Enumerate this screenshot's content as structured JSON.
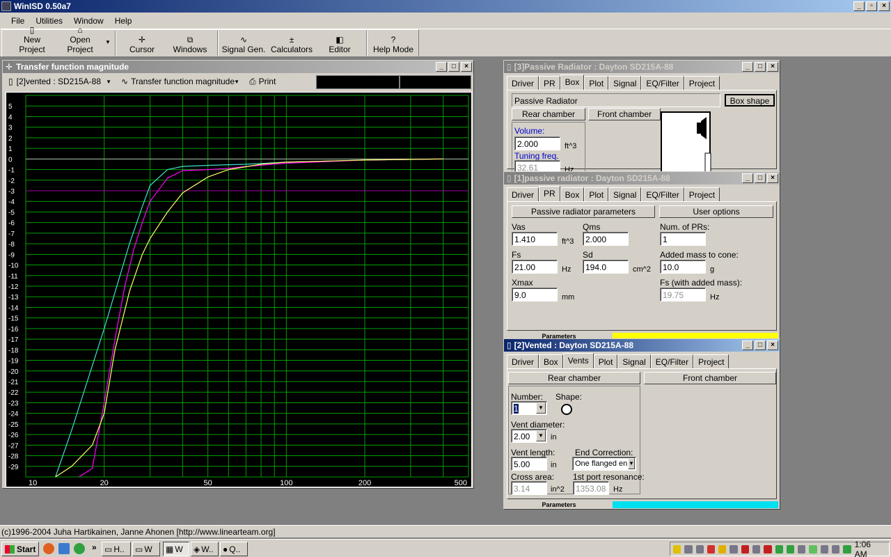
{
  "app": {
    "title": "WinISD 0.50a7"
  },
  "menu": [
    "File",
    "Utilities",
    "Window",
    "Help"
  ],
  "toolbar": [
    {
      "label": "New Project",
      "icon": "new-project-icon"
    },
    {
      "label": "Open Project",
      "icon": "open-project-icon"
    },
    {
      "label": "Cursor",
      "icon": "cursor-icon"
    },
    {
      "label": "Windows",
      "icon": "windows-icon"
    },
    {
      "label": "Signal Gen.",
      "icon": "signal-gen-icon"
    },
    {
      "label": "Calculators",
      "icon": "calculators-icon"
    },
    {
      "label": "Editor",
      "icon": "editor-icon"
    },
    {
      "label": "Help Mode",
      "icon": "help-icon"
    }
  ],
  "chart_window": {
    "title": "Transfer function magnitude",
    "project_select": "[2]vented : SD215A-88",
    "graph_select": "Transfer function magnitude",
    "print_label": "Print"
  },
  "chart_data": {
    "type": "line",
    "title": "Transfer function magnitude",
    "xlabel": "",
    "ylabel": "",
    "x_scale": "log",
    "xlim": [
      10,
      500
    ],
    "ylim": [
      -30,
      6
    ],
    "x_ticks": [
      "10",
      "20",
      "50",
      "100",
      "200",
      "500"
    ],
    "y_ticks": [
      "5",
      "4",
      "3",
      "2",
      "1",
      "0",
      "-1",
      "-2",
      "-3",
      "-4",
      "-5",
      "-6",
      "-7",
      "-8",
      "-9",
      "-10",
      "-11",
      "-12",
      "-13",
      "-14",
      "-15",
      "-16",
      "-17",
      "-18",
      "-19",
      "-20",
      "-21",
      "-22",
      "-23",
      "-24",
      "-25",
      "-26",
      "-27",
      "-28",
      "-29"
    ],
    "reference_line": -3,
    "grid": true,
    "series": [
      {
        "color": "#40e0d0",
        "x": [
          13,
          15,
          18,
          20,
          23,
          25,
          28,
          30,
          35,
          40,
          50,
          70,
          100,
          200
        ],
        "y": [
          -30,
          -25.6,
          -19.5,
          -16,
          -11,
          -8,
          -4.5,
          -2.5,
          -1,
          -0.7,
          -0.6,
          -0.5,
          -0.3,
          -0.1
        ]
      },
      {
        "color": "#ff00ff",
        "x": [
          16,
          18,
          20,
          22,
          24,
          26,
          28,
          30,
          35,
          40,
          50,
          60,
          70,
          100,
          200
        ],
        "y": [
          -30,
          -29.2,
          -23,
          -17,
          -12,
          -8.5,
          -6,
          -4,
          -1.8,
          -1.1,
          -1,
          -0.9,
          -0.7,
          -0.4,
          -0.1
        ]
      },
      {
        "color": "#ffff66",
        "x": [
          13,
          15,
          18,
          20,
          22,
          25,
          28,
          30,
          35,
          40,
          50,
          60,
          80,
          100,
          200
        ],
        "y": [
          -30,
          -29,
          -27,
          -24,
          -18,
          -12.5,
          -9,
          -7.5,
          -5,
          -3.2,
          -1.7,
          -1,
          -0.5,
          -0.3,
          -0.1
        ]
      }
    ]
  },
  "pr3_window": {
    "title": "[3]Passive Radiator : Dayton SD215A-88",
    "tabs": [
      "Driver",
      "PR",
      "Box",
      "Plot",
      "Signal",
      "EQ/Filter",
      "Project"
    ],
    "selected_tab": "Box",
    "box_type": "Passive Radiator",
    "box_shape_btn": "Box shape",
    "rear_chamber": "Rear chamber",
    "front_chamber": "Front chamber",
    "volume_label": "Volume:",
    "volume_value": "2.000",
    "volume_unit": "ft^3",
    "tuning_label": "Tuning freq.",
    "tuning_value": "32.61",
    "tuning_unit": "Hz"
  },
  "pr1_window": {
    "title": "[1]passive radiator : Dayton SD215A-88",
    "tabs": [
      "Driver",
      "PR",
      "Box",
      "Plot",
      "Signal",
      "EQ/Filter",
      "Project"
    ],
    "selected_tab": "PR",
    "params_btn": "Passive radiator parameters",
    "user_options_btn": "User options",
    "vas_label": "Vas",
    "vas_value": "1.410",
    "vas_unit": "ft^3",
    "qms_label": "Qms",
    "qms_value": "2.000",
    "fs_label": "Fs",
    "fs_value": "21.00",
    "fs_unit": "Hz",
    "sd_label": "Sd",
    "sd_value": "194.0",
    "sd_unit": "cm^2",
    "xmax_label": "Xmax",
    "xmax_value": "9.0",
    "xmax_unit": "mm",
    "num_prs_label": "Num. of PRs:",
    "num_prs_value": "1",
    "added_mass_label": "Added mass to cone:",
    "added_mass_value": "10.0",
    "added_mass_unit": "g",
    "fs_added_label": "Fs (with added mass):",
    "fs_added_value": "19.75",
    "fs_added_unit": "Hz",
    "status_label": "Parameters",
    "status_color": "#ffff00"
  },
  "vented_window": {
    "title": "[2]Vented : Dayton SD215A-88",
    "tabs": [
      "Driver",
      "Box",
      "Vents",
      "Plot",
      "Signal",
      "EQ/Filter",
      "Project"
    ],
    "selected_tab": "Vents",
    "rear_chamber": "Rear chamber",
    "front_chamber": "Front chamber",
    "number_label": "Number:",
    "number_value": "1",
    "shape_label": "Shape:",
    "diameter_label": "Vent diameter:",
    "diameter_value": "2.00",
    "diameter_unit": "in",
    "length_label": "Vent length:",
    "length_value": "5.00",
    "length_unit": "in",
    "end_corr_label": "End Correction:",
    "end_corr_value": "One flanged en",
    "cross_area_label": "Cross area:",
    "cross_area_value": "3.14",
    "cross_area_unit": "in^2",
    "port_res_label": "1st port resonance:",
    "port_res_value": "1353.08",
    "port_res_unit": "Hz",
    "status_label": "Parameters",
    "status_color": "#00e0f0"
  },
  "statusbar": {
    "text": "(c)1996-2004 Juha Hartikainen, Janne Ahonen [http://www.linearteam.org]"
  },
  "taskbar": {
    "start_label": "Start",
    "tasks": [
      "H..",
      "W",
      "W",
      "W..",
      "Q.."
    ],
    "clock": "1:06 AM"
  }
}
